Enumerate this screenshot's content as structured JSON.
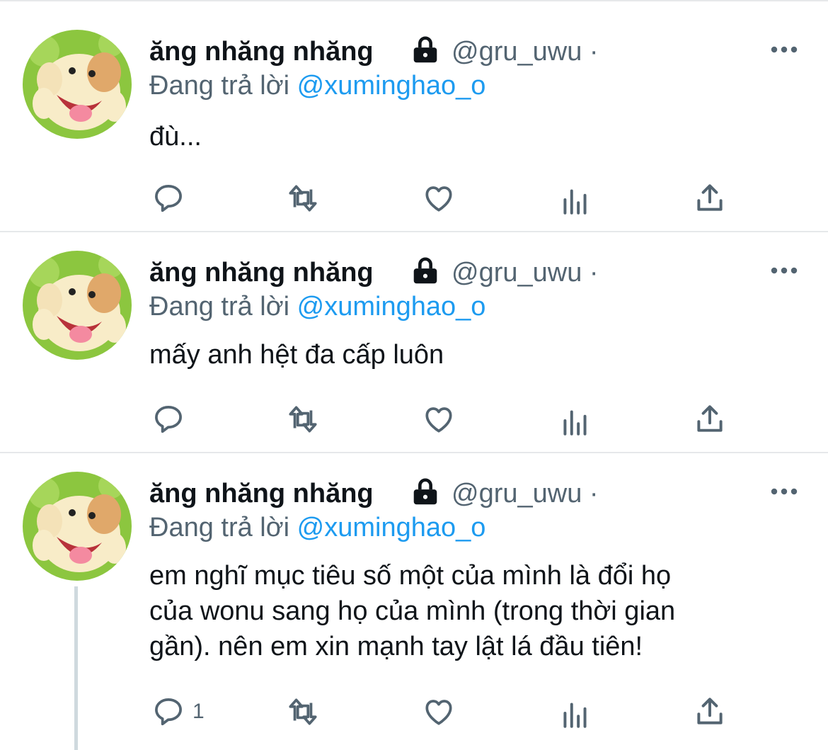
{
  "tweets": [
    {
      "display_name": "ăng nhăng nhăng",
      "handle": "@gru_uwu ·",
      "reply_prefix": "Đang trả lời",
      "reply_to": "@xuminghao_o",
      "text": "đù...",
      "reply_count": "",
      "icons": [
        "avatar",
        "lock-icon",
        "more-icon",
        "reply-icon",
        "retweet-icon",
        "like-icon",
        "analytics-icon",
        "share-icon"
      ]
    },
    {
      "display_name": "ăng nhăng nhăng",
      "handle": "@gru_uwu ·",
      "reply_prefix": "Đang trả lời",
      "reply_to": "@xuminghao_o",
      "text": "mấy anh hệt đa cấp luôn",
      "reply_count": ""
    },
    {
      "display_name": "ăng nhăng nhăng",
      "handle": "@gru_uwu ·",
      "reply_prefix": "Đang trả lời",
      "reply_to": "@xuminghao_o",
      "text_lines": [
        "em nghĩ mục tiêu số một của mình là đổi họ",
        "của wonu sang họ của mình (trong thời gian",
        "gần). nên em xin mạnh tay lật lá đầu tiên!"
      ],
      "reply_count": "1"
    }
  ],
  "colors": {
    "link": "#1d9bf0",
    "secondary": "#536471",
    "text": "#0f1419",
    "divider": "#e6e8ea",
    "thread_line": "#cfd9de"
  }
}
